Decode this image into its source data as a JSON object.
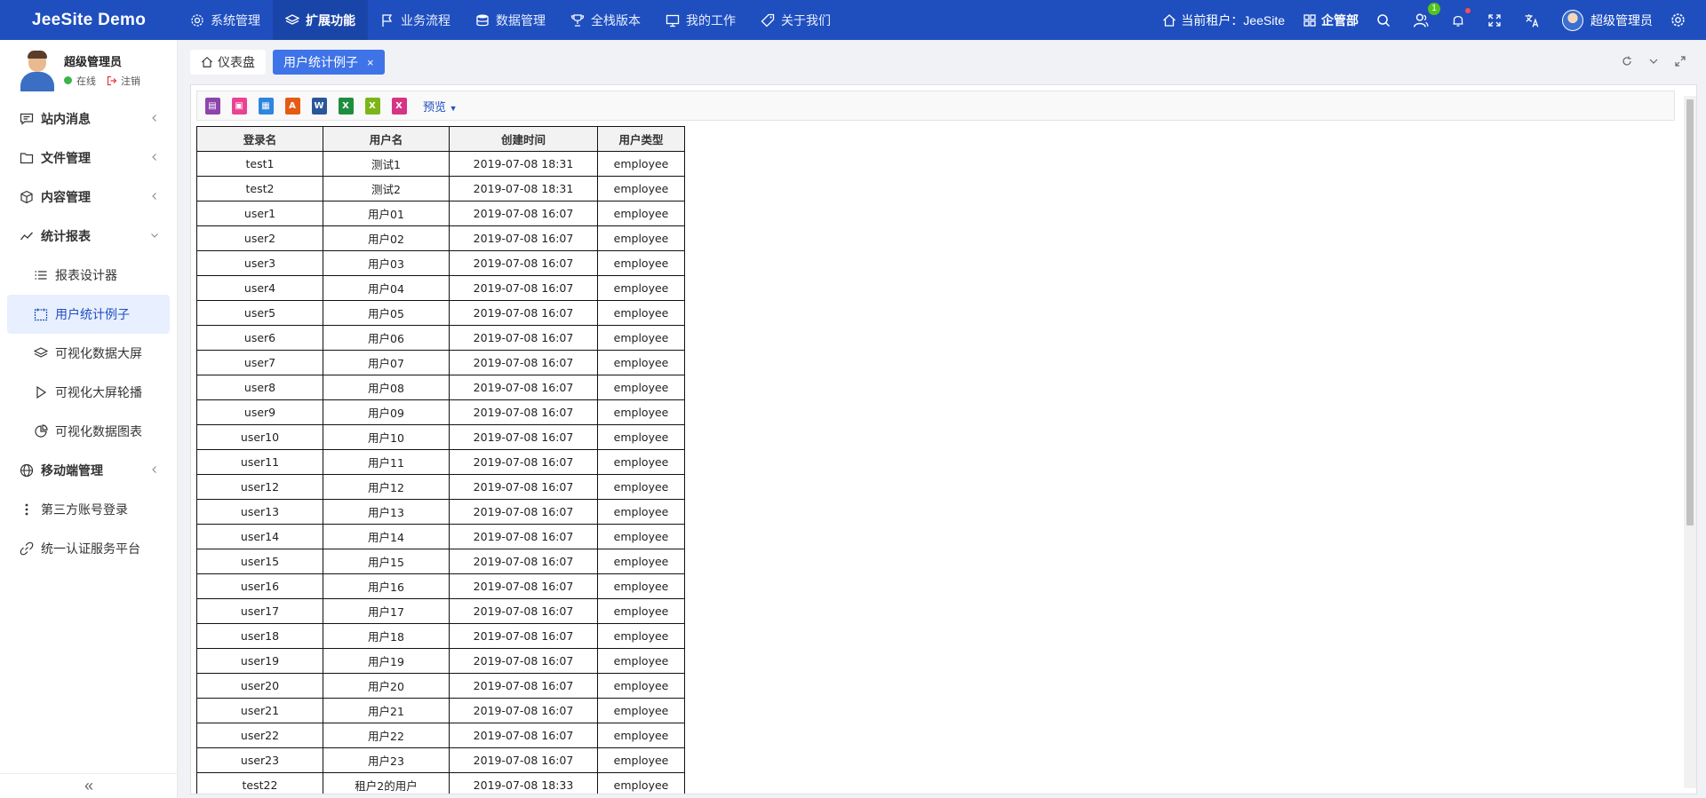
{
  "app": {
    "title": "JeeSite Demo"
  },
  "topnav": [
    {
      "label": "系统管理",
      "icon": "gear-icon",
      "active": false
    },
    {
      "label": "扩展功能",
      "icon": "layers-icon",
      "active": true
    },
    {
      "label": "业务流程",
      "icon": "flag-icon",
      "active": false
    },
    {
      "label": "数据管理",
      "icon": "database-icon",
      "active": false
    },
    {
      "label": "全栈版本",
      "icon": "trophy-icon",
      "active": false
    },
    {
      "label": "我的工作",
      "icon": "monitor-icon",
      "active": false
    },
    {
      "label": "关于我们",
      "icon": "tag-icon",
      "active": false
    }
  ],
  "topright": {
    "tenant_label": "当前租户：JeeSite",
    "org_label": "企管部",
    "user_badge": "1",
    "user_name": "超级管理员"
  },
  "sidebar": {
    "user": {
      "name": "超级管理员",
      "status": "在线",
      "logout": "注销"
    },
    "menu": [
      {
        "label": "站内消息",
        "icon": "message-icon"
      },
      {
        "label": "文件管理",
        "icon": "folder-icon"
      },
      {
        "label": "内容管理",
        "icon": "cube-icon"
      },
      {
        "label": "统计报表",
        "icon": "chart-line-icon"
      },
      {
        "label": "报表设计器",
        "icon": "list-icon"
      },
      {
        "label": "用户统计例子",
        "icon": "calendar-icon"
      },
      {
        "label": "可视化数据大屏",
        "icon": "layers-icon"
      },
      {
        "label": "可视化大屏轮播",
        "icon": "play-icon"
      },
      {
        "label": "可视化数据图表",
        "icon": "pie-icon"
      },
      {
        "label": "移动端管理",
        "icon": "globe-icon"
      },
      {
        "label": "第三方账号登录",
        "icon": "more-vertical-icon"
      },
      {
        "label": "统一认证服务平台",
        "icon": "link-icon"
      }
    ],
    "collapse": "«"
  },
  "tabs": [
    {
      "label": "仪表盘"
    },
    {
      "label": "用户统计例子",
      "close": "×"
    }
  ],
  "toolbar": {
    "preview_label": "预览",
    "tools": [
      {
        "name": "print-icon",
        "color": "#8e44ad",
        "glyph": "▤"
      },
      {
        "name": "print-preview-icon",
        "color": "#e84393",
        "glyph": "▣"
      },
      {
        "name": "page-setup-icon",
        "color": "#2e86de",
        "glyph": "▦"
      },
      {
        "name": "pdf-icon",
        "color": "#e55b13",
        "glyph": "A"
      },
      {
        "name": "word-icon",
        "color": "#2b579a",
        "glyph": "W"
      },
      {
        "name": "excel-icon",
        "color": "#1e8e3e",
        "glyph": "X"
      },
      {
        "name": "excel-paging-icon",
        "color": "#7cb518",
        "glyph": "X"
      },
      {
        "name": "excel-sheet-icon",
        "color": "#d63384",
        "glyph": "X"
      }
    ]
  },
  "table": {
    "headers": [
      "登录名",
      "用户名",
      "创建时间",
      "用户类型"
    ],
    "rows": [
      [
        "test1",
        "测试1",
        "2019-07-08 18:31",
        "employee"
      ],
      [
        "test2",
        "测试2",
        "2019-07-08 18:31",
        "employee"
      ],
      [
        "user1",
        "用户01",
        "2019-07-08 16:07",
        "employee"
      ],
      [
        "user2",
        "用户02",
        "2019-07-08 16:07",
        "employee"
      ],
      [
        "user3",
        "用户03",
        "2019-07-08 16:07",
        "employee"
      ],
      [
        "user4",
        "用户04",
        "2019-07-08 16:07",
        "employee"
      ],
      [
        "user5",
        "用户05",
        "2019-07-08 16:07",
        "employee"
      ],
      [
        "user6",
        "用户06",
        "2019-07-08 16:07",
        "employee"
      ],
      [
        "user7",
        "用户07",
        "2019-07-08 16:07",
        "employee"
      ],
      [
        "user8",
        "用户08",
        "2019-07-08 16:07",
        "employee"
      ],
      [
        "user9",
        "用户09",
        "2019-07-08 16:07",
        "employee"
      ],
      [
        "user10",
        "用户10",
        "2019-07-08 16:07",
        "employee"
      ],
      [
        "user11",
        "用户11",
        "2019-07-08 16:07",
        "employee"
      ],
      [
        "user12",
        "用户12",
        "2019-07-08 16:07",
        "employee"
      ],
      [
        "user13",
        "用户13",
        "2019-07-08 16:07",
        "employee"
      ],
      [
        "user14",
        "用户14",
        "2019-07-08 16:07",
        "employee"
      ],
      [
        "user15",
        "用户15",
        "2019-07-08 16:07",
        "employee"
      ],
      [
        "user16",
        "用户16",
        "2019-07-08 16:07",
        "employee"
      ],
      [
        "user17",
        "用户17",
        "2019-07-08 16:07",
        "employee"
      ],
      [
        "user18",
        "用户18",
        "2019-07-08 16:07",
        "employee"
      ],
      [
        "user19",
        "用户19",
        "2019-07-08 16:07",
        "employee"
      ],
      [
        "user20",
        "用户20",
        "2019-07-08 16:07",
        "employee"
      ],
      [
        "user21",
        "用户21",
        "2019-07-08 16:07",
        "employee"
      ],
      [
        "user22",
        "用户22",
        "2019-07-08 16:07",
        "employee"
      ],
      [
        "user23",
        "用户23",
        "2019-07-08 16:07",
        "employee"
      ],
      [
        "test22",
        "租户2的用户",
        "2019-07-08 18:33",
        "employee"
      ]
    ]
  }
}
